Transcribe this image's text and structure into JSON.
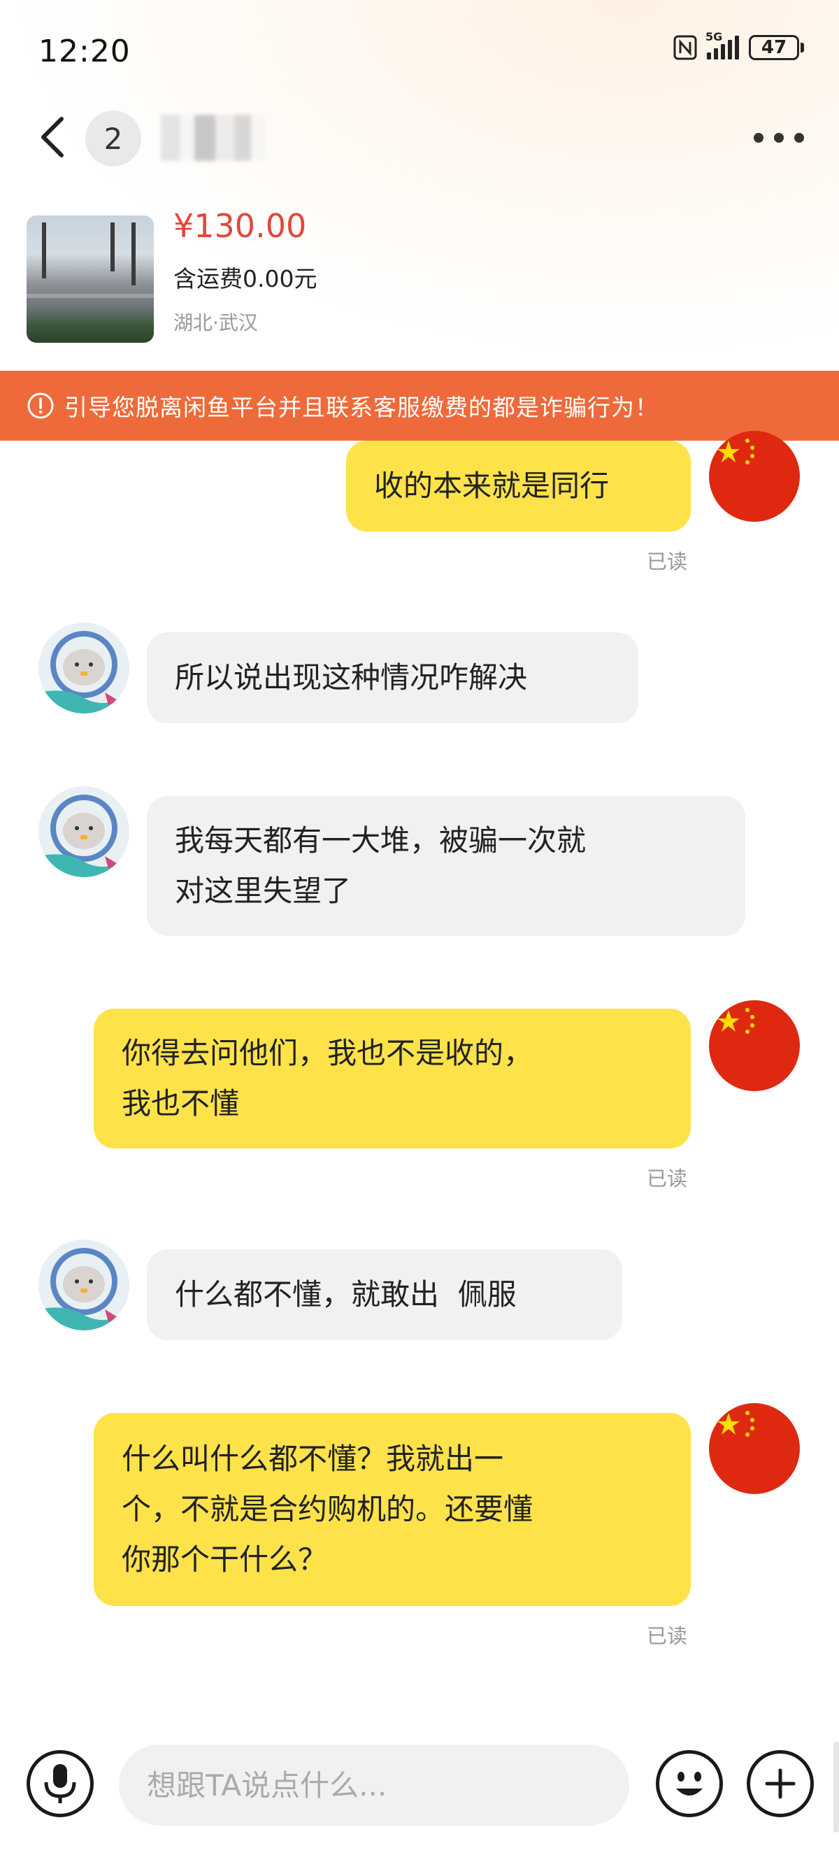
{
  "status_bar": {
    "time": "12:20",
    "network": "5G",
    "battery": "47"
  },
  "header": {
    "unread_count": "2",
    "contact_name": ""
  },
  "product": {
    "price": "¥130.00",
    "shipping": "含运费0.00元",
    "location": "湖北·武汉"
  },
  "warning": {
    "text": "引导您脱离闲鱼平台并且联系客服缴费的都是诈骗行为！"
  },
  "messages": [
    {
      "from": "me",
      "lines": [
        "收的本来就是同行"
      ],
      "status": "已读"
    },
    {
      "from": "them",
      "lines": [
        "所以说出现这种情况咋解决"
      ]
    },
    {
      "from": "them",
      "lines": [
        "我每天都有一大堆，被骗一次就",
        "对这里失望了"
      ]
    },
    {
      "from": "me",
      "lines": [
        "你得去问他们，我也不是收的，",
        "我也不懂"
      ],
      "status": "已读"
    },
    {
      "from": "them",
      "lines": [
        "什么都不懂，就敢出  佩服"
      ]
    },
    {
      "from": "me",
      "lines": [
        "什么叫什么都不懂？我就出一",
        "个，不就是合约购机的。还要懂",
        "你那个干什么？"
      ],
      "status": "已读"
    }
  ],
  "input": {
    "placeholder": "想跟TA说点什么..."
  },
  "colors": {
    "price": "#e1473d",
    "warning_bg": "#ef6a3a",
    "my_bubble": "#fde24a",
    "their_bubble": "#f1f1f3"
  },
  "icons": [
    "back-icon",
    "more-icon",
    "warning-icon",
    "microphone-icon",
    "emoji-icon",
    "plus-icon"
  ]
}
